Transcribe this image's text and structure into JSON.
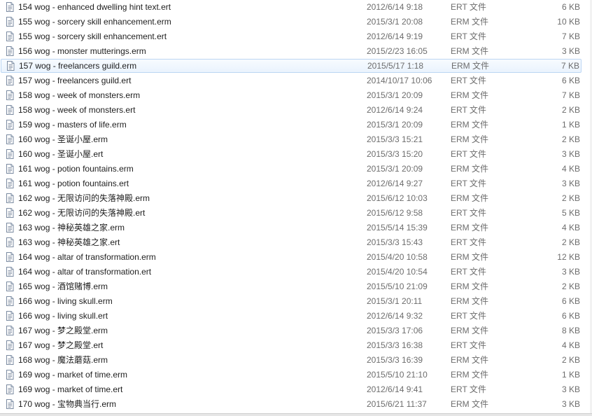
{
  "files": [
    {
      "name": "154 wog - enhanced dwelling hint text.ert",
      "date": "2012/6/14 9:18",
      "type": "ERT 文件",
      "size": "6 KB"
    },
    {
      "name": "155 wog - sorcery skill enhancement.erm",
      "date": "2015/3/1 20:08",
      "type": "ERM 文件",
      "size": "10 KB"
    },
    {
      "name": "155 wog - sorcery skill enhancement.ert",
      "date": "2012/6/14 9:19",
      "type": "ERT 文件",
      "size": "7 KB"
    },
    {
      "name": "156 wog - monster mutterings.erm",
      "date": "2015/2/23 16:05",
      "type": "ERM 文件",
      "size": "3 KB"
    },
    {
      "name": "157 wog - freelancers guild.erm",
      "date": "2015/5/17 1:18",
      "type": "ERM 文件",
      "size": "7 KB",
      "selected": true
    },
    {
      "name": "157 wog - freelancers guild.ert",
      "date": "2014/10/17 10:06",
      "type": "ERT 文件",
      "size": "6 KB"
    },
    {
      "name": "158 wog - week of monsters.erm",
      "date": "2015/3/1 20:09",
      "type": "ERM 文件",
      "size": "7 KB"
    },
    {
      "name": "158 wog - week of monsters.ert",
      "date": "2012/6/14 9:24",
      "type": "ERT 文件",
      "size": "2 KB"
    },
    {
      "name": "159 wog - masters of life.erm",
      "date": "2015/3/1 20:09",
      "type": "ERM 文件",
      "size": "1 KB"
    },
    {
      "name": "160 wog - 圣诞小屋.erm",
      "date": "2015/3/3 15:21",
      "type": "ERM 文件",
      "size": "2 KB"
    },
    {
      "name": "160 wog - 圣诞小屋.ert",
      "date": "2015/3/3 15:20",
      "type": "ERT 文件",
      "size": "3 KB"
    },
    {
      "name": "161 wog - potion fountains.erm",
      "date": "2015/3/1 20:09",
      "type": "ERM 文件",
      "size": "4 KB"
    },
    {
      "name": "161 wog - potion fountains.ert",
      "date": "2012/6/14 9:27",
      "type": "ERT 文件",
      "size": "3 KB"
    },
    {
      "name": "162 wog - 无限访问的失落神殿.erm",
      "date": "2015/6/12 10:03",
      "type": "ERM 文件",
      "size": "2 KB"
    },
    {
      "name": "162 wog - 无限访问的失落神殿.ert",
      "date": "2015/6/12 9:58",
      "type": "ERT 文件",
      "size": "5 KB"
    },
    {
      "name": "163 wog - 神秘英雄之家.erm",
      "date": "2015/5/14 15:39",
      "type": "ERM 文件",
      "size": "4 KB"
    },
    {
      "name": "163 wog - 神秘英雄之家.ert",
      "date": "2015/3/3 15:43",
      "type": "ERT 文件",
      "size": "2 KB"
    },
    {
      "name": "164 wog - altar of transformation.erm",
      "date": "2015/4/20 10:58",
      "type": "ERM 文件",
      "size": "12 KB"
    },
    {
      "name": "164 wog - altar of transformation.ert",
      "date": "2015/4/20 10:54",
      "type": "ERT 文件",
      "size": "3 KB"
    },
    {
      "name": "165 wog - 酒馆赌博.erm",
      "date": "2015/5/10 21:09",
      "type": "ERM 文件",
      "size": "2 KB"
    },
    {
      "name": "166 wog - living skull.erm",
      "date": "2015/3/1 20:11",
      "type": "ERM 文件",
      "size": "6 KB"
    },
    {
      "name": "166 wog - living skull.ert",
      "date": "2012/6/14 9:32",
      "type": "ERT 文件",
      "size": "6 KB"
    },
    {
      "name": "167 wog - 梦之殿堂.erm",
      "date": "2015/3/3 17:06",
      "type": "ERM 文件",
      "size": "8 KB"
    },
    {
      "name": "167 wog - 梦之殿堂.ert",
      "date": "2015/3/3 16:38",
      "type": "ERT 文件",
      "size": "4 KB"
    },
    {
      "name": "168 wog - 魔法蘑菇.erm",
      "date": "2015/3/3 16:39",
      "type": "ERM 文件",
      "size": "2 KB"
    },
    {
      "name": "169 wog - market of time.erm",
      "date": "2015/5/10 21:10",
      "type": "ERM 文件",
      "size": "1 KB"
    },
    {
      "name": "169 wog - market of time.ert",
      "date": "2012/6/14 9:41",
      "type": "ERT 文件",
      "size": "3 KB"
    },
    {
      "name": "170 wog - 宝物典当行.erm",
      "date": "2015/6/21 11:37",
      "type": "ERM 文件",
      "size": "3 KB"
    }
  ],
  "icon": "text-file-icon"
}
